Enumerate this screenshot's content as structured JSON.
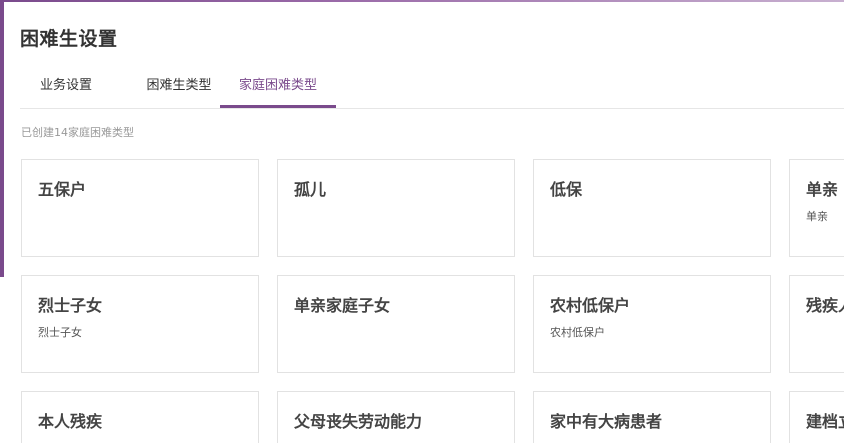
{
  "page": {
    "title": "困难生设置"
  },
  "tabs": [
    {
      "label": "业务设置",
      "active": false
    },
    {
      "label": "困难生类型",
      "active": false
    },
    {
      "label": "家庭困难类型",
      "active": true
    }
  ],
  "summary": {
    "count_text": "已创建14家庭困难类型"
  },
  "colors": {
    "accent": "#7a4a8c",
    "border": "#e2e2e2"
  },
  "cards": [
    {
      "title": "五保户",
      "desc": ""
    },
    {
      "title": "孤儿",
      "desc": ""
    },
    {
      "title": "低保",
      "desc": ""
    },
    {
      "title": "单亲",
      "desc": "单亲"
    },
    {
      "title": "烈士子女",
      "desc": "烈士子女"
    },
    {
      "title": "单亲家庭子女",
      "desc": ""
    },
    {
      "title": "农村低保户",
      "desc": "农村低保户"
    },
    {
      "title": "残疾人",
      "desc": ""
    },
    {
      "title": "本人残疾",
      "desc": ""
    },
    {
      "title": "父母丧失劳动能力",
      "desc": ""
    },
    {
      "title": "家中有大病患者",
      "desc": ""
    },
    {
      "title": "建档立",
      "desc": ""
    }
  ]
}
